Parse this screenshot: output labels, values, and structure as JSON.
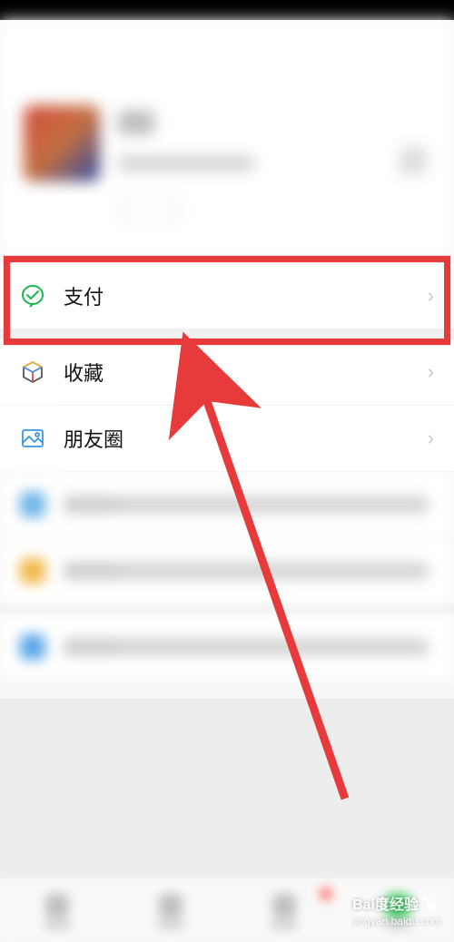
{
  "menu": {
    "pay": {
      "label": "支付"
    },
    "favorites": {
      "label": "收藏"
    },
    "moments": {
      "label": "朋友圈"
    }
  },
  "watermark": {
    "line1": "Bai度经验",
    "line2": "jingyan.baidu.com"
  }
}
